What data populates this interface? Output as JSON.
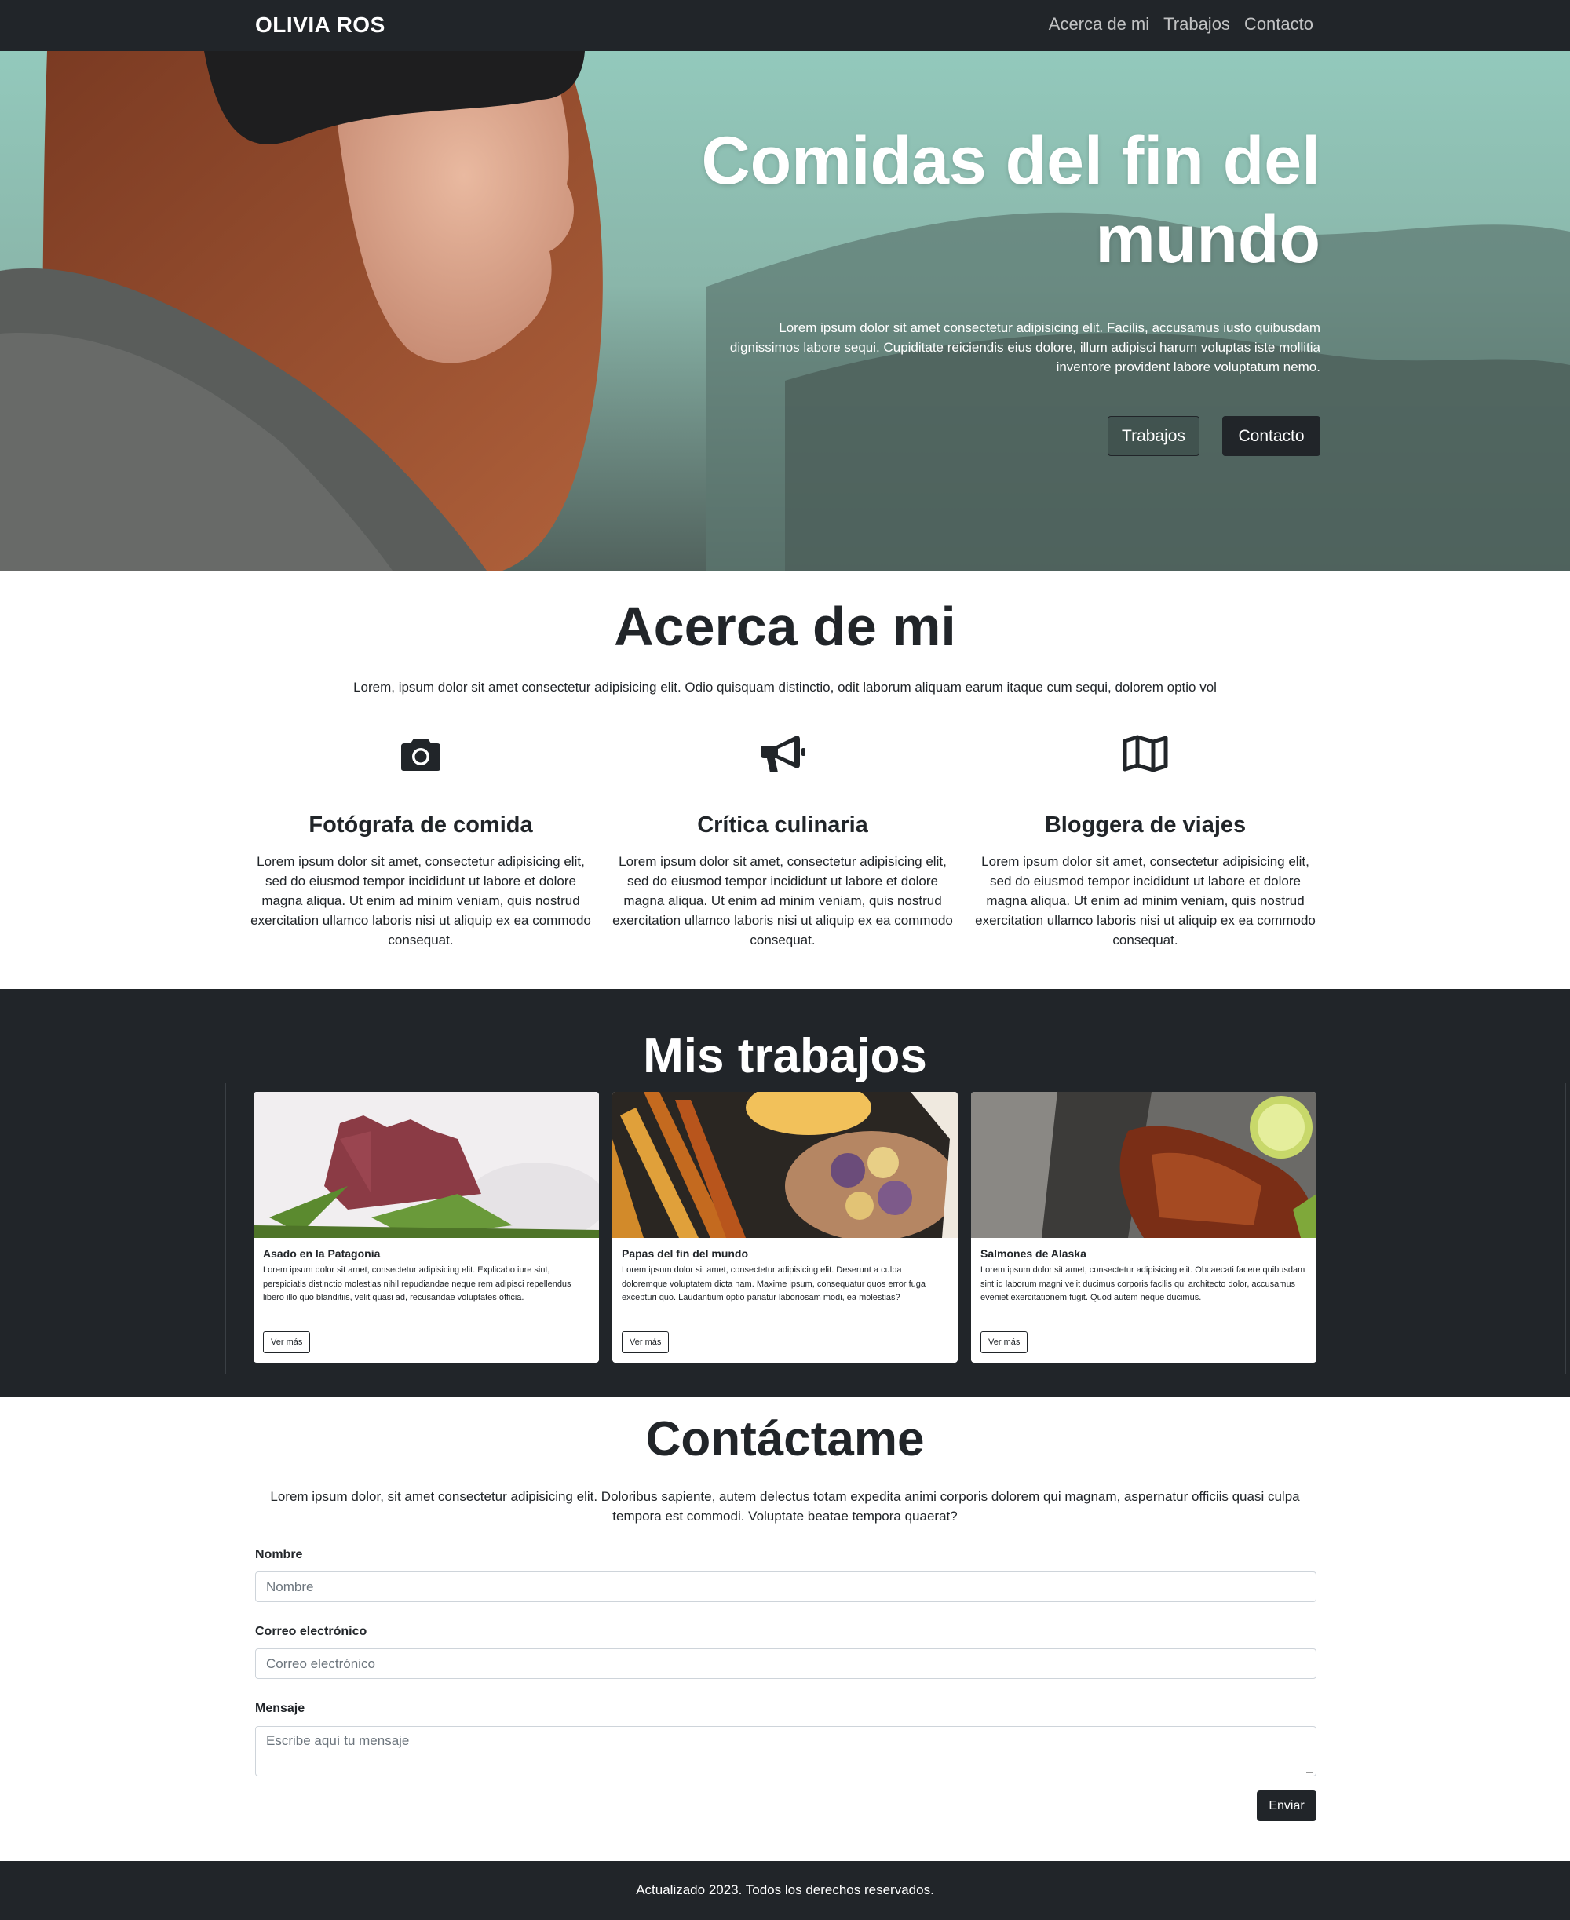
{
  "navbar": {
    "brand": "OLIVIA ROS",
    "links": [
      "Acerca de mi",
      "Trabajos",
      "Contacto"
    ]
  },
  "hero": {
    "title_line1": "Comidas del fin del",
    "title_line2": "mundo",
    "lead_line1": "Lorem ipsum dolor sit amet consectetur adipisicing elit. Facilis, accusamus iusto quibusdam",
    "lead_line2": "dignissimos labore sequi. Cupiditate reiciendis eius dolore, illum adipisci harum voluptas iste mollitia",
    "lead_line3": "inventore provident labore voluptatum nemo.",
    "btn_works": "Trabajos",
    "btn_contact": "Contacto"
  },
  "about": {
    "title": "Acerca de mi",
    "lead": "Lorem, ipsum dolor sit amet consectetur adipisicing elit. Odio quisquam distinctio, odit laborum aliquam earum itaque cum sequi, dolorem optio vol",
    "features": [
      {
        "icon": "camera-icon",
        "title": "Fotógrafa de comida",
        "text": "Lorem ipsum dolor sit amet, consectetur adipisicing elit, sed do eiusmod tempor incididunt ut labore et dolore magna aliqua. Ut enim ad minim veniam, quis nostrud exercitation ullamco laboris nisi ut aliquip ex ea commodo consequat."
      },
      {
        "icon": "megaphone-icon",
        "title": "Crítica culinaria",
        "text": "Lorem ipsum dolor sit amet, consectetur adipisicing elit, sed do eiusmod tempor incididunt ut labore et dolore magna aliqua. Ut enim ad minim veniam, quis nostrud exercitation ullamco laboris nisi ut aliquip ex ea commodo consequat."
      },
      {
        "icon": "map-icon",
        "title": "Bloggera de viajes",
        "text": "Lorem ipsum dolor sit amet, consectetur adipisicing elit, sed do eiusmod tempor incididunt ut labore et dolore magna aliqua. Ut enim ad minim veniam, quis nostrud exercitation ullamco laboris nisi ut aliquip ex ea commodo consequat."
      }
    ]
  },
  "works": {
    "title": "Mis trabajos",
    "cards": [
      {
        "title": "Asado en la Patagonia",
        "text": "Lorem ipsum dolor sit amet, consectetur adipisicing elit. Explicabo iure sint, perspiciatis distinctio molestias nihil repudiandae neque rem adipisci repellendus libero illo quo blanditiis, velit quasi ad, recusandae voluptates officia.",
        "button": "Ver más"
      },
      {
        "title": "Papas del fin del mundo",
        "text": "Lorem ipsum dolor sit amet, consectetur adipisicing elit. Deserunt a culpa doloremque voluptatem dicta nam. Maxime ipsum, consequatur quos error fuga excepturi quo. Laudantium optio pariatur laboriosam modi, ea molestias?",
        "button": "Ver más"
      },
      {
        "title": "Salmones de Alaska",
        "text": "Lorem ipsum dolor sit amet, consectetur adipisicing elit. Obcaecati facere quibusdam sint id laborum magni velit ducimus corporis facilis qui architecto dolor, accusamus eveniet exercitationem fugit. Quod autem neque ducimus.",
        "button": "Ver más"
      }
    ]
  },
  "contact": {
    "title": "Contáctame",
    "lead": "Lorem ipsum dolor, sit amet consectetur adipisicing elit. Doloribus sapiente, autem delectus totam expedita animi corporis dolorem qui magnam, aspernatur officiis quasi culpa tempora est commodi. Voluptate beatae tempora quaerat?",
    "name_label": "Nombre",
    "name_placeholder": "Nombre",
    "email_label": "Correo electrónico",
    "email_placeholder": "Correo electrónico",
    "message_label": "Mensaje",
    "message_placeholder": "Escribe aquí tu mensaje",
    "submit": "Enviar"
  },
  "footer": {
    "text": "Actualizado 2023. Todos los derechos reservados."
  }
}
